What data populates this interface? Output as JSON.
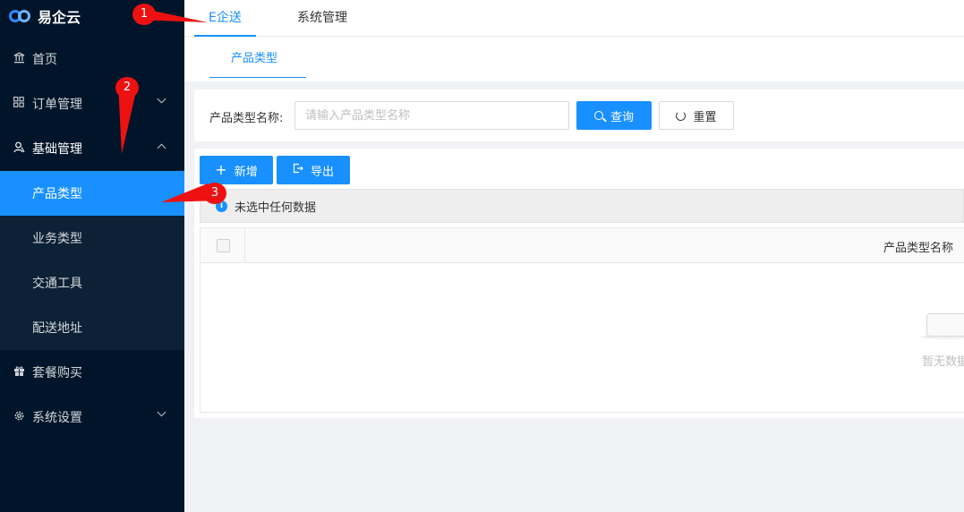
{
  "app": {
    "name": "易企云"
  },
  "sidebar": {
    "items": [
      {
        "label": "首页",
        "icon": "bank-icon"
      },
      {
        "label": "订单管理",
        "icon": "grid-icon"
      },
      {
        "label": "基础管理",
        "icon": "user-icon"
      },
      {
        "label": "套餐购买",
        "icon": "gift-icon"
      },
      {
        "label": "系统设置",
        "icon": "gear-icon"
      }
    ],
    "submenu": [
      {
        "label": "产品类型",
        "active": true
      },
      {
        "label": "业务类型"
      },
      {
        "label": "交通工具"
      },
      {
        "label": "配送地址"
      }
    ]
  },
  "top_tabs": [
    {
      "label": "E企送",
      "active": true
    },
    {
      "label": "系统管理"
    }
  ],
  "page_tab": {
    "label": "产品类型"
  },
  "search": {
    "label": "产品类型名称:",
    "placeholder": "请输入产品类型名称",
    "query_label": "查询",
    "reset_label": "重置"
  },
  "toolbar": {
    "add_label": "新增",
    "export_label": "导出"
  },
  "alert": {
    "text": "未选中任何数据"
  },
  "table": {
    "columns": [
      "产品类型名称"
    ],
    "empty_text": "暂无数据"
  },
  "annotations": [
    "1",
    "2",
    "3"
  ],
  "colors": {
    "primary": "#1890ff",
    "sidebar": "#001529",
    "annotation": "#ee1111"
  }
}
